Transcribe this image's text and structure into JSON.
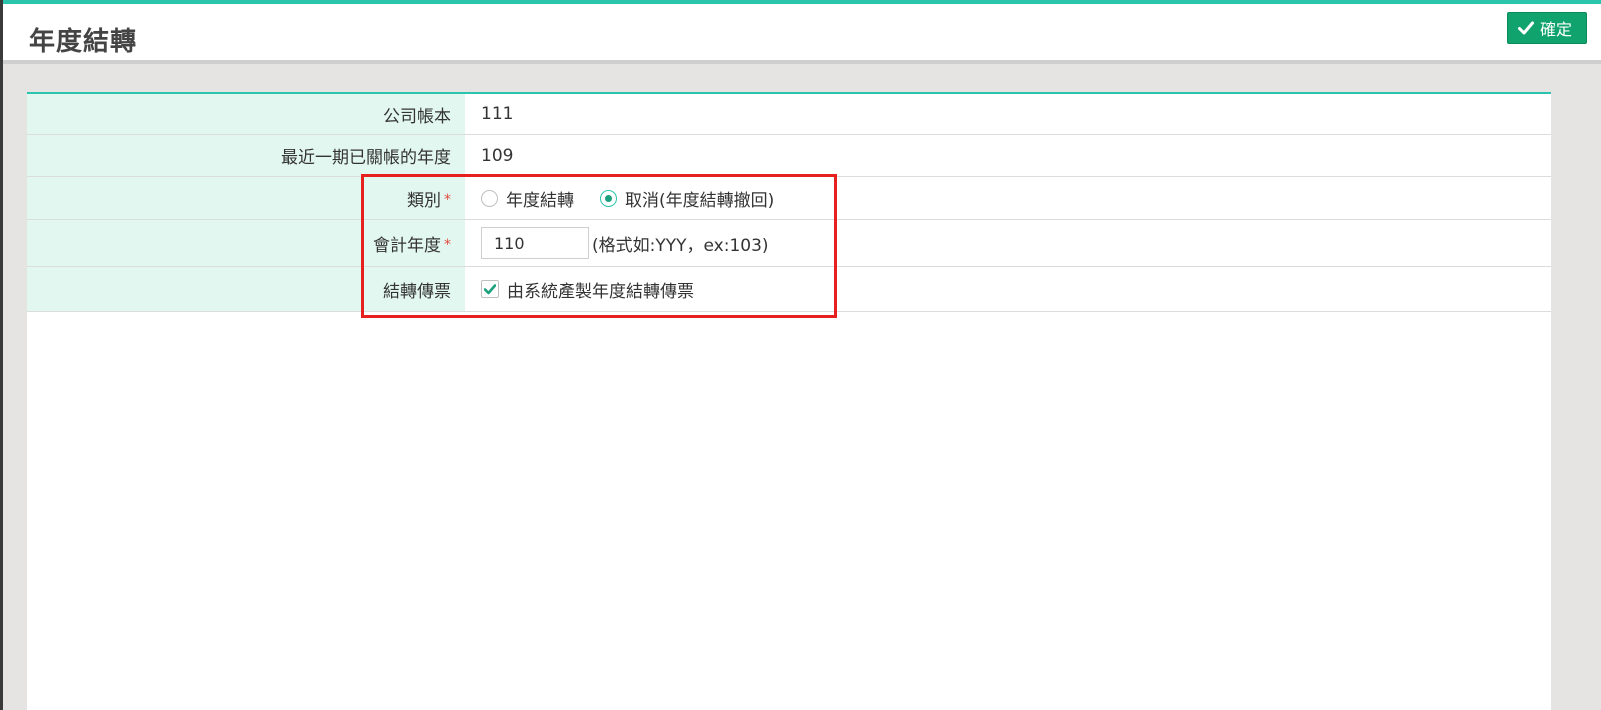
{
  "page": {
    "title": "年度結轉"
  },
  "toolbar": {
    "confirm_label": "確定",
    "confirm_icon": "check-icon"
  },
  "form": {
    "company_book": {
      "label": "公司帳本",
      "value": "111"
    },
    "last_closed_year": {
      "label": "最近一期已關帳的年度",
      "value": "109"
    },
    "category": {
      "label": "類別",
      "required_mark": "*",
      "options": [
        {
          "label": "年度結轉",
          "selected": false
        },
        {
          "label": "取消(年度結轉撤回)",
          "selected": true
        }
      ]
    },
    "fiscal_year": {
      "label": "會計年度",
      "required_mark": "*",
      "value": "110",
      "hint": "(格式如:YYY，ex:103)"
    },
    "transfer_voucher": {
      "label": "結轉傳票",
      "checkbox_label": "由系統產製年度結轉傳票",
      "checked": true
    }
  },
  "colors": {
    "accent": "#2bc5ad",
    "confirm_button": "#11a36d",
    "label_background": "#e3f7f1",
    "highlight_border": "#e61f1f"
  }
}
